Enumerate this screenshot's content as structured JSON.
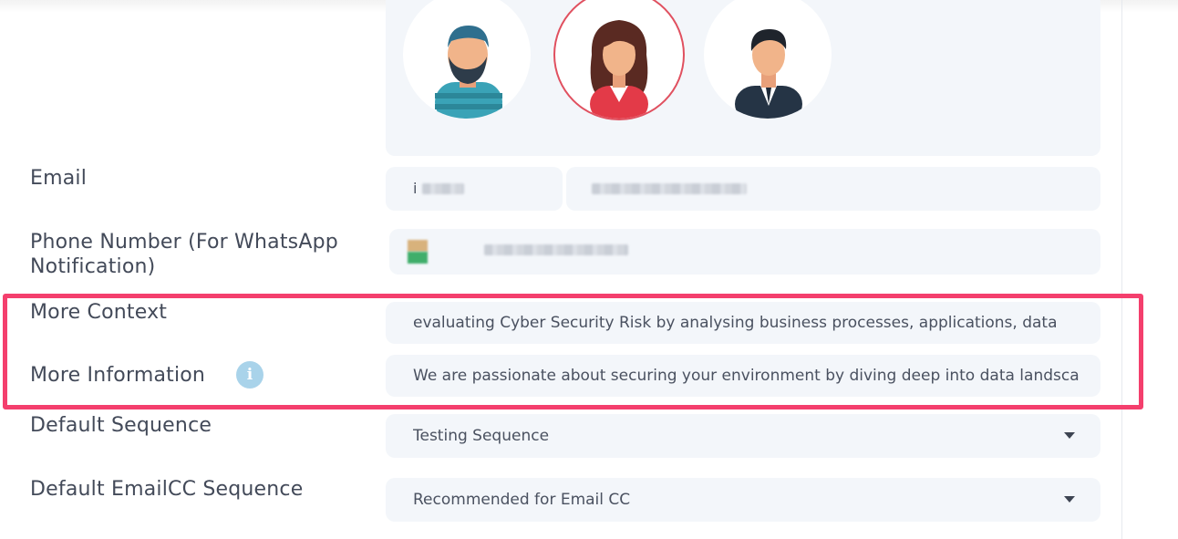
{
  "profile": {
    "avatars": [
      {
        "icon": "man-beard-avatar-icon",
        "selected": false
      },
      {
        "icon": "woman-avatar-icon",
        "selected": true
      },
      {
        "icon": "man-suit-avatar-icon",
        "selected": false
      }
    ]
  },
  "form": {
    "email_label": "Email",
    "email_local_value": "i",
    "phone_label_line1": "Phone Number (For WhatsApp",
    "phone_label_line2": "Notification)",
    "more_context_label": "More Context",
    "more_context_value": "evaluating Cyber Security Risk by analysing business processes, applications, data",
    "more_information_label": "More Information",
    "info_icon_glyph": "i",
    "more_information_value": "We are passionate about securing your environment by diving deep into data landscape",
    "default_sequence_label": "Default Sequence",
    "default_sequence_value": "Testing Sequence",
    "default_emailcc_label": "Default EmailCC Sequence",
    "default_emailcc_value": "Recommended for Email CC"
  },
  "colors": {
    "highlight": "#f43f6d",
    "field_background": "#f3f6fa",
    "selected_avatar_ring": "#e0505f",
    "info_icon": "#a9d3ea"
  }
}
